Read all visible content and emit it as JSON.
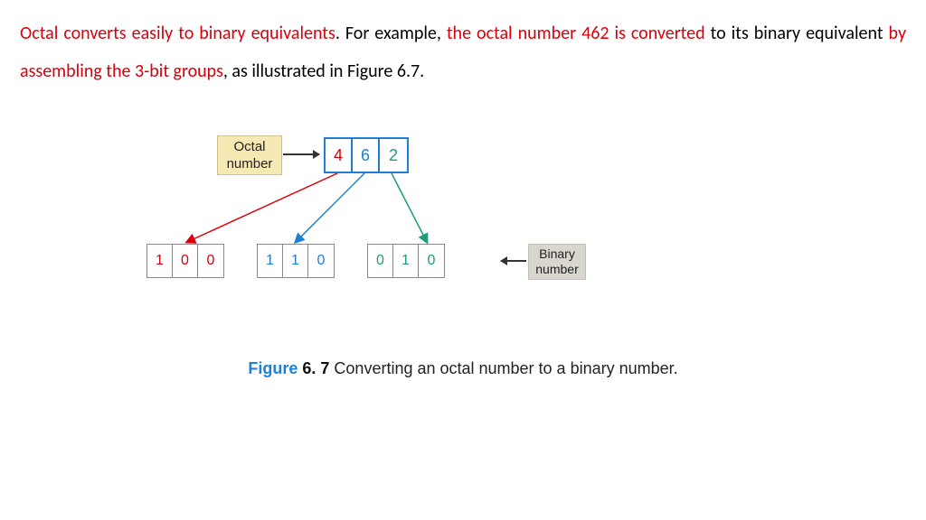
{
  "paragraph": {
    "s1": "Octal converts easily to binary equivalents",
    "s2": ". For example, ",
    "s3": "the octal number 462 is converted",
    "s4": " to its binary equivalent ",
    "s5": "by assembling the 3-bit groups",
    "s6": ", as illustrated in Figure 6.7."
  },
  "diagram": {
    "octal_label_line1": "Octal",
    "octal_label_line2": "number",
    "octal_digits": {
      "d1": "4",
      "d2": "6",
      "d3": "2"
    },
    "binary_groups": {
      "g1": {
        "b1": "1",
        "b2": "0",
        "b3": "0"
      },
      "g2": {
        "b1": "1",
        "b2": "1",
        "b3": "0"
      },
      "g3": {
        "b1": "0",
        "b2": "1",
        "b3": "0"
      }
    },
    "binary_label_line1": "Binary",
    "binary_label_line2": "number"
  },
  "caption": {
    "figure_word": "Figure",
    "figure_num": "6. 7",
    "text": "  Converting an octal number to a binary number."
  },
  "colors": {
    "red": "#d9000b",
    "blue": "#1e7fd6",
    "green": "#1a9e7a"
  }
}
